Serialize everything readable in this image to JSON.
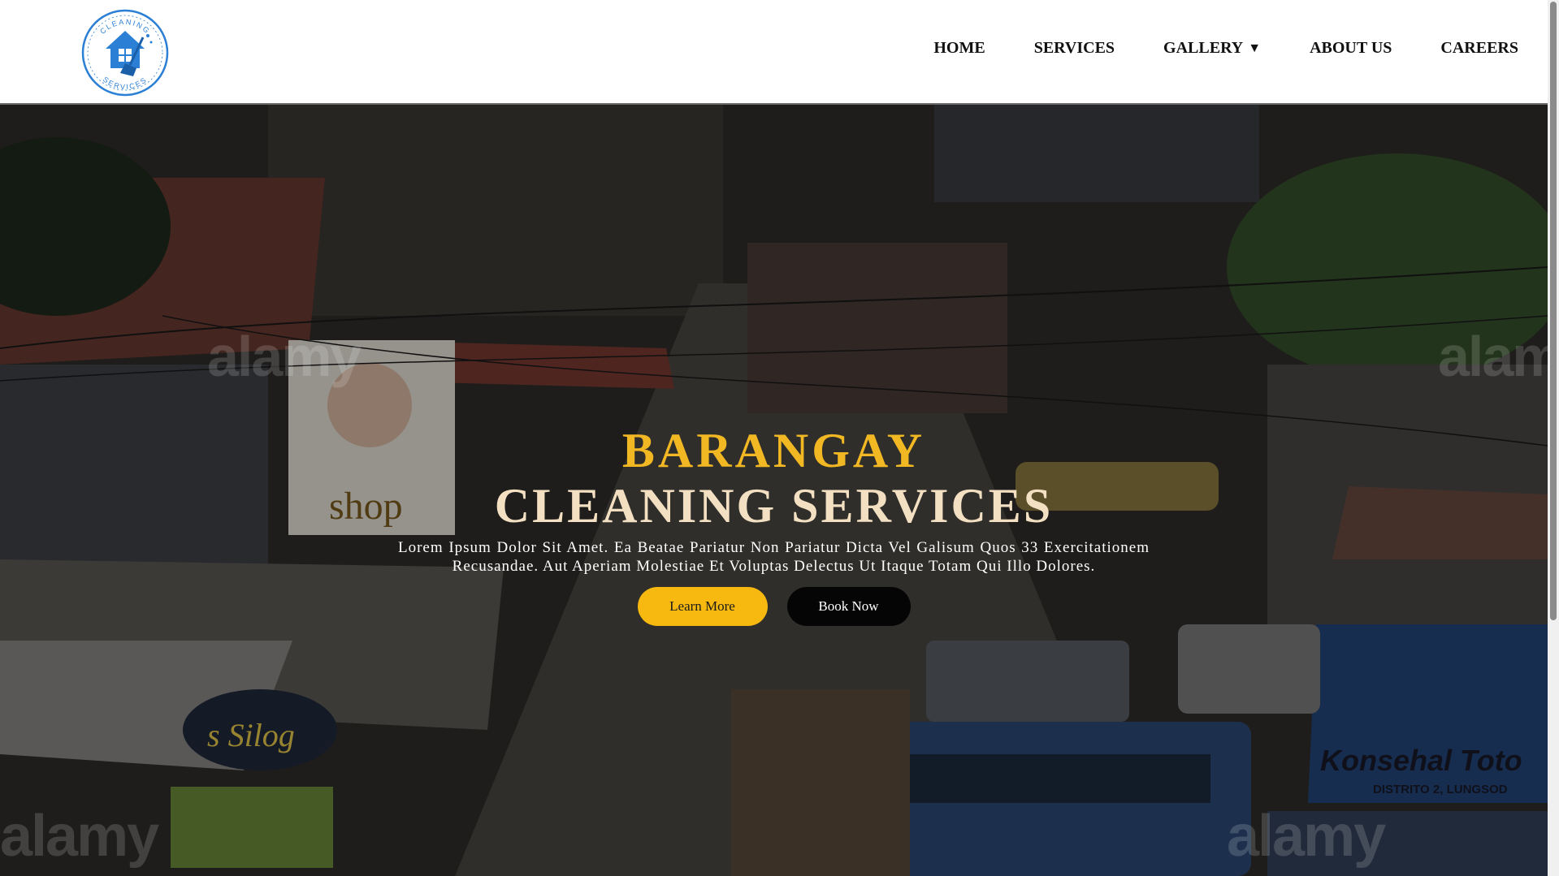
{
  "brand": {
    "logo_top_text": "CLEANING",
    "logo_bottom_text": "SERVICES"
  },
  "nav": {
    "items": [
      {
        "label": "HOME"
      },
      {
        "label": "SERVICES"
      },
      {
        "label": "GALLERY",
        "caret": "▼"
      },
      {
        "label": "ABOUT US"
      },
      {
        "label": "CAREERS"
      }
    ]
  },
  "hero": {
    "title_line1": "BARANGAY",
    "title_line2": "CLEANING SERVICES",
    "description": "Lorem Ipsum Dolor Sit Amet. Ea Beatae Pariatur Non Pariatur Dicta Vel Galisum Quos 33 Exercitationem Recusandae. Aut Aperiam Molestiae Et Voluptas Delectus Ut Itaque Totam Qui Illo Dolores.",
    "learn_more_label": "Learn More",
    "book_now_label": "Book Now",
    "image_signs": {
      "shop": "shop",
      "silog": "s Silog",
      "konsehal": "Konsehal Toto",
      "distrito": "DISTRITO 2, LUNGSOD"
    },
    "watermark": "alamy"
  },
  "colors": {
    "accent_yellow": "#f2b824",
    "title_cream": "#f3dfc1",
    "learn_button": "#f7b90f",
    "book_button": "#050505",
    "logo_blue": "#2b7fd4"
  }
}
